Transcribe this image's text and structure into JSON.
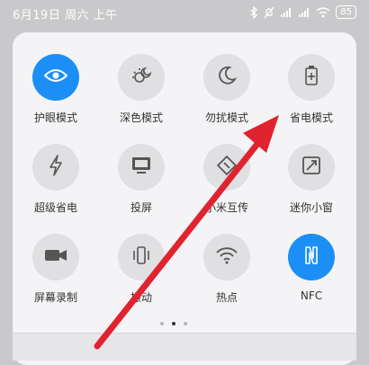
{
  "status_bar": {
    "time": "6月19日 周六 上午",
    "battery": "85",
    "icons": [
      "bluetooth-icon",
      "alarm-off-icon",
      "signal-icon",
      "signal-icon",
      "wifi-icon",
      "battery-icon"
    ]
  },
  "quick_settings": {
    "tiles": [
      {
        "label": "护眼模式",
        "icon": "eye-icon",
        "active": true
      },
      {
        "label": "深色模式",
        "icon": "dark-mode-icon",
        "active": false
      },
      {
        "label": "勿扰模式",
        "icon": "moon-icon",
        "active": false
      },
      {
        "label": "省电模式",
        "icon": "battery-saver-icon",
        "active": false
      },
      {
        "label": "超级省电",
        "icon": "lightning-icon",
        "active": false
      },
      {
        "label": "投屏",
        "icon": "screen-cast-icon",
        "active": false
      },
      {
        "label": "小米互传",
        "icon": "share-icon",
        "active": false
      },
      {
        "label": "迷你小窗",
        "icon": "mini-window-icon",
        "active": false
      },
      {
        "label": "屏幕录制",
        "icon": "camera-icon",
        "active": false
      },
      {
        "label": "振动",
        "icon": "vibrate-icon",
        "active": false
      },
      {
        "label": "热点",
        "icon": "hotspot-icon",
        "active": false
      },
      {
        "label": "NFC",
        "icon": "nfc-icon",
        "active": true
      }
    ],
    "page_indicator": {
      "pages": 3,
      "current": 2
    }
  },
  "annotation": {
    "color": "#e0232e"
  },
  "colors": {
    "accent": "#1b8ff5",
    "tile_bg": "#e0e0e3",
    "panel_bg": "#f4f4f6"
  }
}
